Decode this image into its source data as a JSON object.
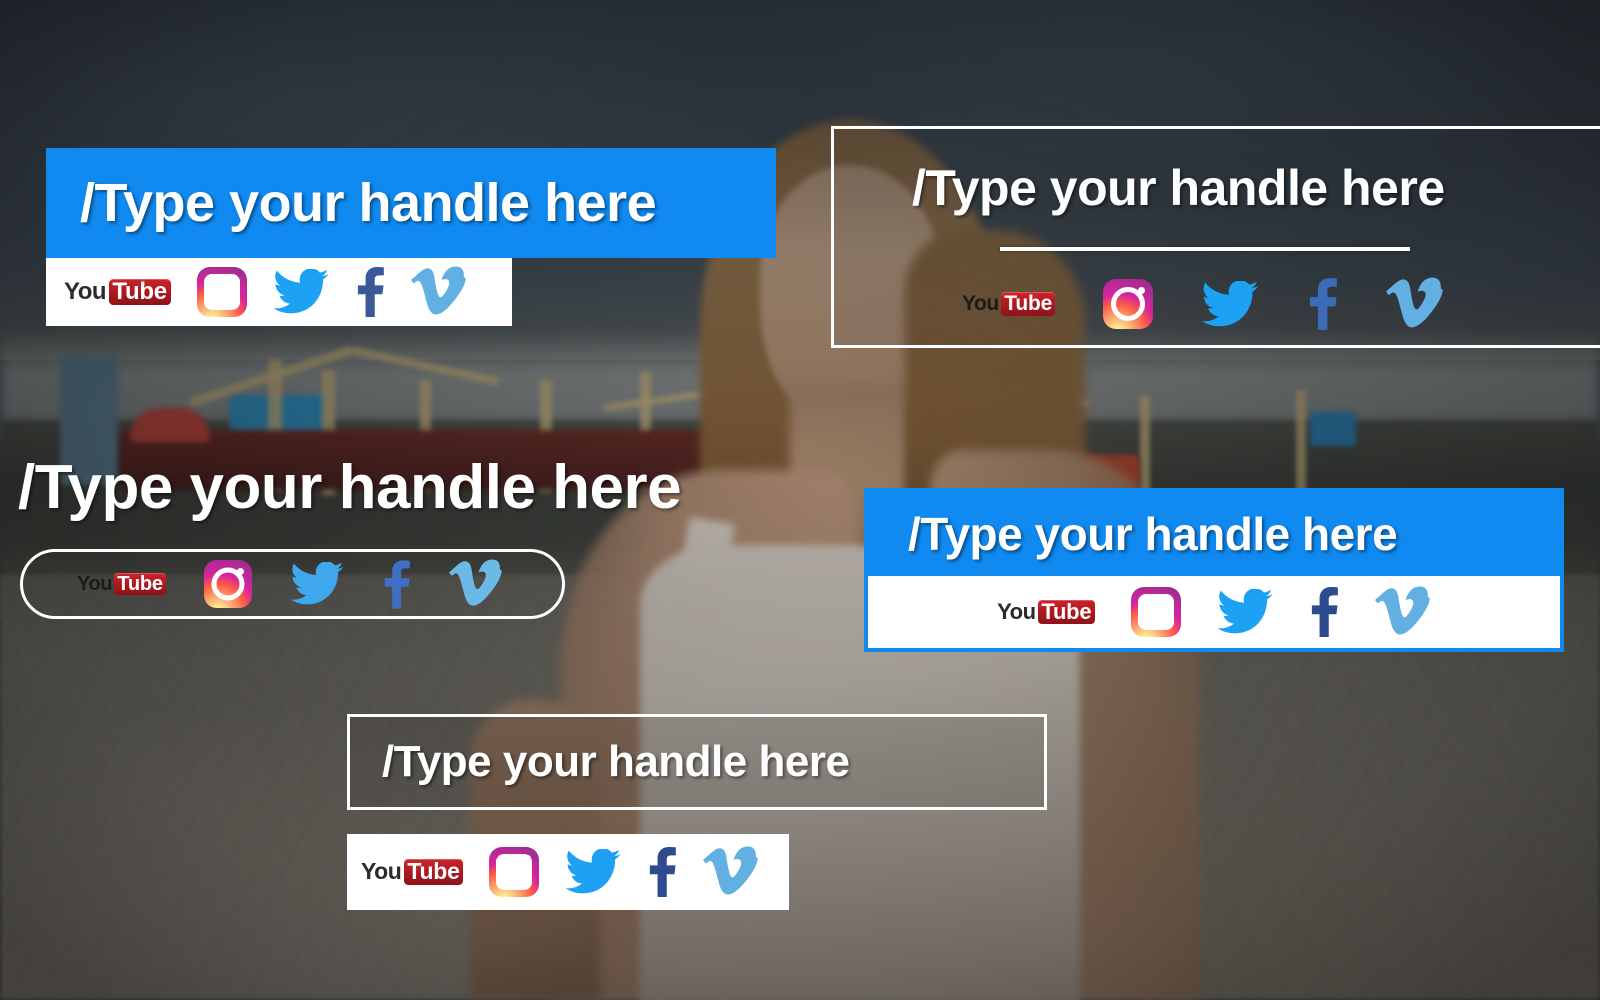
{
  "scene": {
    "background_description": "blurred harbour scene with young woman in foreground",
    "sky_color": "#3c4751",
    "ground_color": "#8d887c"
  },
  "brand": {
    "accent_blue": "#1089f0",
    "white": "#ffffff",
    "youtube_red": "#cf2229",
    "twitter_blue": "#1da1f2",
    "facebook_blue": "#3b5998",
    "vimeo_blue": "#62b0e1",
    "instagram_gradient_start": "#fdf497",
    "instagram_gradient_end": "#a02d8f"
  },
  "social_icons": [
    {
      "id": "youtube",
      "name": "youtube-icon",
      "word_you": "You",
      "word_tube": "Tube"
    },
    {
      "id": "instagram",
      "name": "instagram-icon",
      "label": "Instagram"
    },
    {
      "id": "twitter",
      "name": "twitter-icon",
      "label": "Twitter"
    },
    {
      "id": "facebook",
      "name": "facebook-icon",
      "label": "Facebook"
    },
    {
      "id": "vimeo",
      "name": "vimeo-icon",
      "label": "Vimeo"
    }
  ],
  "lower_thirds": [
    {
      "id": "panel-solid-blue-top-left",
      "style": "solid blue bar with white icon strip",
      "headline": "/Type your handle here",
      "bar_color": "#1089f0",
      "icon_strip_color": "#ffffff",
      "icons": [
        "youtube",
        "instagram",
        "twitter",
        "facebook",
        "vimeo"
      ]
    },
    {
      "id": "panel-outline-top-right",
      "style": "white outlined transparent box with divider rule",
      "headline": "/Type your handle here",
      "border_color": "#ffffff",
      "divider_color": "#ffffff",
      "icons": [
        "youtube",
        "instagram",
        "twitter",
        "facebook",
        "vimeo"
      ]
    },
    {
      "id": "panel-bare-middle-left",
      "style": "plain white headline with rounded pill icon outline",
      "headline": "/Type your handle here",
      "pill_border_color": "#ffffff",
      "icons": [
        "youtube",
        "instagram",
        "twitter",
        "facebook",
        "vimeo"
      ]
    },
    {
      "id": "panel-blue-middle-right",
      "style": "blue bar over bordered white icon strip",
      "headline": "/Type your handle here",
      "bar_color": "#1089f0",
      "icon_strip_color": "#ffffff",
      "icons": [
        "youtube",
        "instagram",
        "twitter",
        "facebook",
        "vimeo"
      ]
    },
    {
      "id": "panel-outline-bottom-center",
      "style": "white outlined box with separate white icon strip below",
      "headline": "/Type your handle here",
      "border_color": "#ffffff",
      "icon_strip_color": "#ffffff",
      "icons": [
        "youtube",
        "instagram",
        "twitter",
        "facebook",
        "vimeo"
      ]
    }
  ]
}
